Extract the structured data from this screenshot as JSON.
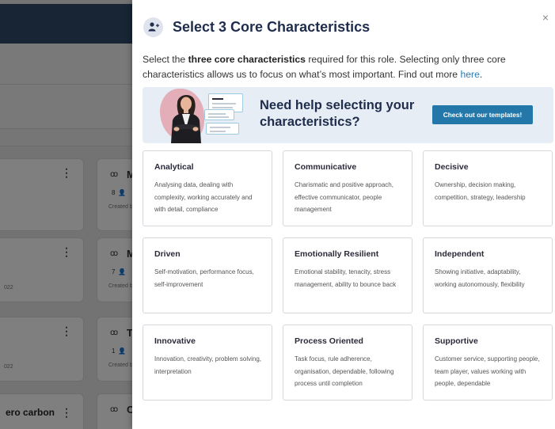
{
  "background": {
    "cards_left": [
      {
        "title": "",
        "date": ""
      },
      {
        "title": "",
        "date": "022"
      },
      {
        "title": "",
        "date": "022"
      },
      {
        "title": "ero carbon",
        "date": ""
      }
    ],
    "cards_right": [
      {
        "letter": "M",
        "count": "8",
        "created": "Created b"
      },
      {
        "letter": "M",
        "count": "7",
        "created": "Created b"
      },
      {
        "letter": "T",
        "count": "1",
        "created": "Created b"
      },
      {
        "letter": "C",
        "count": "",
        "created": ""
      }
    ],
    "kebab": "⋮",
    "glyph": "ꝏ",
    "person_glyph": "👤"
  },
  "panel": {
    "title": "Select 3 Core Characteristics",
    "close_label": "×",
    "intro": {
      "before": "Select the ",
      "bold": "three core characteristics",
      "after": " required for this role. Selecting only three core characteristics allows us to focus on what’s most important. Find out more ",
      "link": "here",
      "end": "."
    },
    "help": {
      "title_line1": "Need help selecting your",
      "title_line2": "characteristics?",
      "button_label": "Check out our templates!"
    },
    "characteristics": [
      {
        "name": "Analytical",
        "description": "Analysing data, dealing with complexity, working accurately and with detail, compliance"
      },
      {
        "name": "Communicative",
        "description": "Charismatic and positive approach, effective communicator, people management"
      },
      {
        "name": "Decisive",
        "description": "Ownership, decision making, competition, strategy, leadership"
      },
      {
        "name": "Driven",
        "description": "Self-motivation, performance focus, self-improvement"
      },
      {
        "name": "Emotionally Resilient",
        "description": "Emotional stability, tenacity, stress management, ability to bounce back"
      },
      {
        "name": "Independent",
        "description": "Showing initiative, adaptability, working autonomously, flexibility"
      },
      {
        "name": "Innovative",
        "description": "Innovation, creativity, problem solving, interpretation"
      },
      {
        "name": "Process Oriented",
        "description": "Task focus, rule adherence, organisation, dependable, following process until completion"
      },
      {
        "name": "Supportive",
        "description": "Customer service, supporting people, team player, values working with people, dependable"
      }
    ]
  },
  "colors": {
    "header_bg": "#2e4a6b",
    "title": "#1f2d4d",
    "accent": "#2377a9",
    "link": "#2a7ab3",
    "banner_bg": "#e6edf4"
  }
}
